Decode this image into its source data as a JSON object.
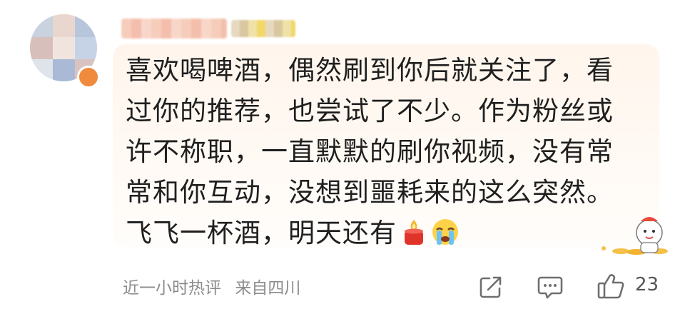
{
  "comment": {
    "text": "喜欢喝啤酒，偶然刷到你后就关注了，看过你的推荐，也尝试了不少。作为粉丝或许不称职，一直默默的刷你视频，没有常常和你互动，没想到噩耗来的这么突然。飞飞一杯酒，明天还有",
    "emojis": [
      "candle-emoji",
      "crying-face-emoji"
    ]
  },
  "footer": {
    "time_label": "近一小时热评",
    "location": "来自四川",
    "like_count": "23"
  },
  "colors": {
    "bubble": "#fff5ec",
    "avatar_badge": "#f08a3c",
    "meta_text": "#8c8c8c"
  },
  "icons": [
    "share-icon",
    "reply-icon",
    "like-icon"
  ]
}
